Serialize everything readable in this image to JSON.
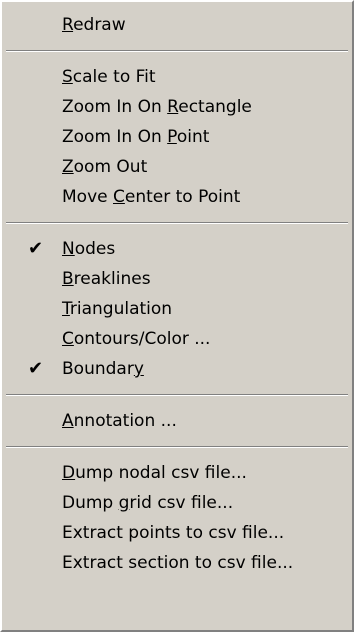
{
  "menu": {
    "groups": [
      {
        "items": [
          {
            "label": "Redraw",
            "mnemonic_index": 0,
            "checked": false
          }
        ]
      },
      {
        "items": [
          {
            "label": "Scale to Fit",
            "mnemonic_index": 0,
            "checked": false
          },
          {
            "label": "Zoom In On Rectangle",
            "mnemonic_index": 11,
            "checked": false
          },
          {
            "label": "Zoom In On Point",
            "mnemonic_index": 11,
            "checked": false
          },
          {
            "label": "Zoom Out",
            "mnemonic_index": 0,
            "checked": false
          },
          {
            "label": "Move Center to Point",
            "mnemonic_index": 5,
            "checked": false
          }
        ]
      },
      {
        "items": [
          {
            "label": "Nodes",
            "mnemonic_index": 0,
            "checked": true
          },
          {
            "label": "Breaklines",
            "mnemonic_index": 0,
            "checked": false
          },
          {
            "label": "Triangulation",
            "mnemonic_index": 0,
            "checked": false
          },
          {
            "label": "Contours/Color ...",
            "mnemonic_index": 0,
            "checked": false
          },
          {
            "label": "Boundary",
            "mnemonic_index": 7,
            "checked": true
          }
        ]
      },
      {
        "items": [
          {
            "label": "Annotation ...",
            "mnemonic_index": 0,
            "checked": false
          }
        ]
      },
      {
        "items": [
          {
            "label": "Dump nodal csv file...",
            "mnemonic_index": 0,
            "checked": false
          },
          {
            "label": "Dump grid csv file...",
            "mnemonic_index": 5,
            "checked": false
          },
          {
            "label": "Extract points to csv file...",
            "mnemonic_index": -1,
            "checked": false
          },
          {
            "label": "Extract section to csv file...",
            "mnemonic_index": -1,
            "checked": false
          }
        ]
      }
    ],
    "check_glyph": "✔",
    "colors": {
      "background": "#d4d0c8",
      "highlight": "#ffffff",
      "shadow": "#808080",
      "text": "#000000"
    }
  }
}
